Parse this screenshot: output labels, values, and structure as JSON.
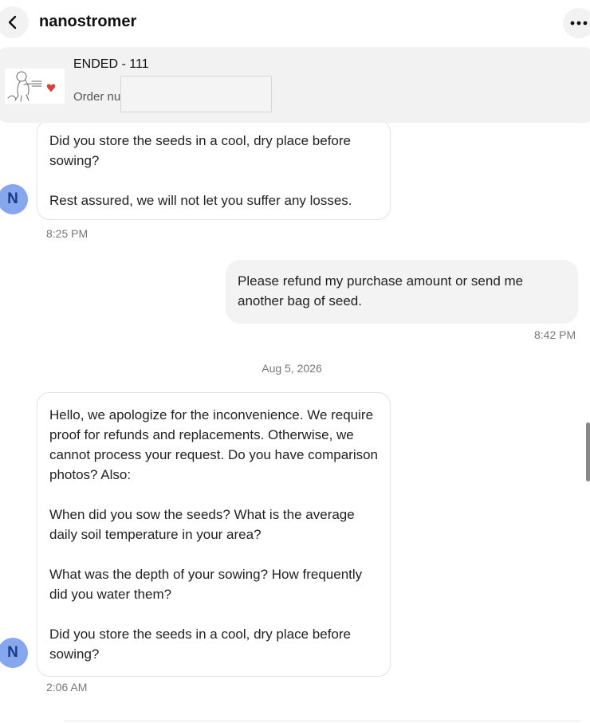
{
  "header": {
    "title": "nanostromer"
  },
  "order": {
    "status": "ENDED - 111",
    "number_label": "Order nu"
  },
  "messages": [
    {
      "paragraphs": [
        "Did you store the seeds in a cool, dry place before sowing?",
        "Rest assured, we will not let you suffer any losses."
      ],
      "time": "8:25 PM",
      "avatar": "N"
    },
    {
      "paragraphs": [
        "Please refund my purchase amount or send me another bag of seed."
      ],
      "time": "8:42 PM"
    },
    {
      "date": "Aug 5, 2026"
    },
    {
      "paragraphs": [
        "Hello, we apologize for the inconvenience. We require proof for refunds and replacements. Otherwise, we cannot process your request. Do you have comparison photos? Also:",
        "When did you sow the seeds? What is the average daily soil temperature in your area?",
        "What was the depth of your sowing? How frequently did you water them?",
        "Did you store the seeds in a cool, dry place before sowing?"
      ],
      "time": "2:06 AM",
      "avatar": "N"
    }
  ]
}
